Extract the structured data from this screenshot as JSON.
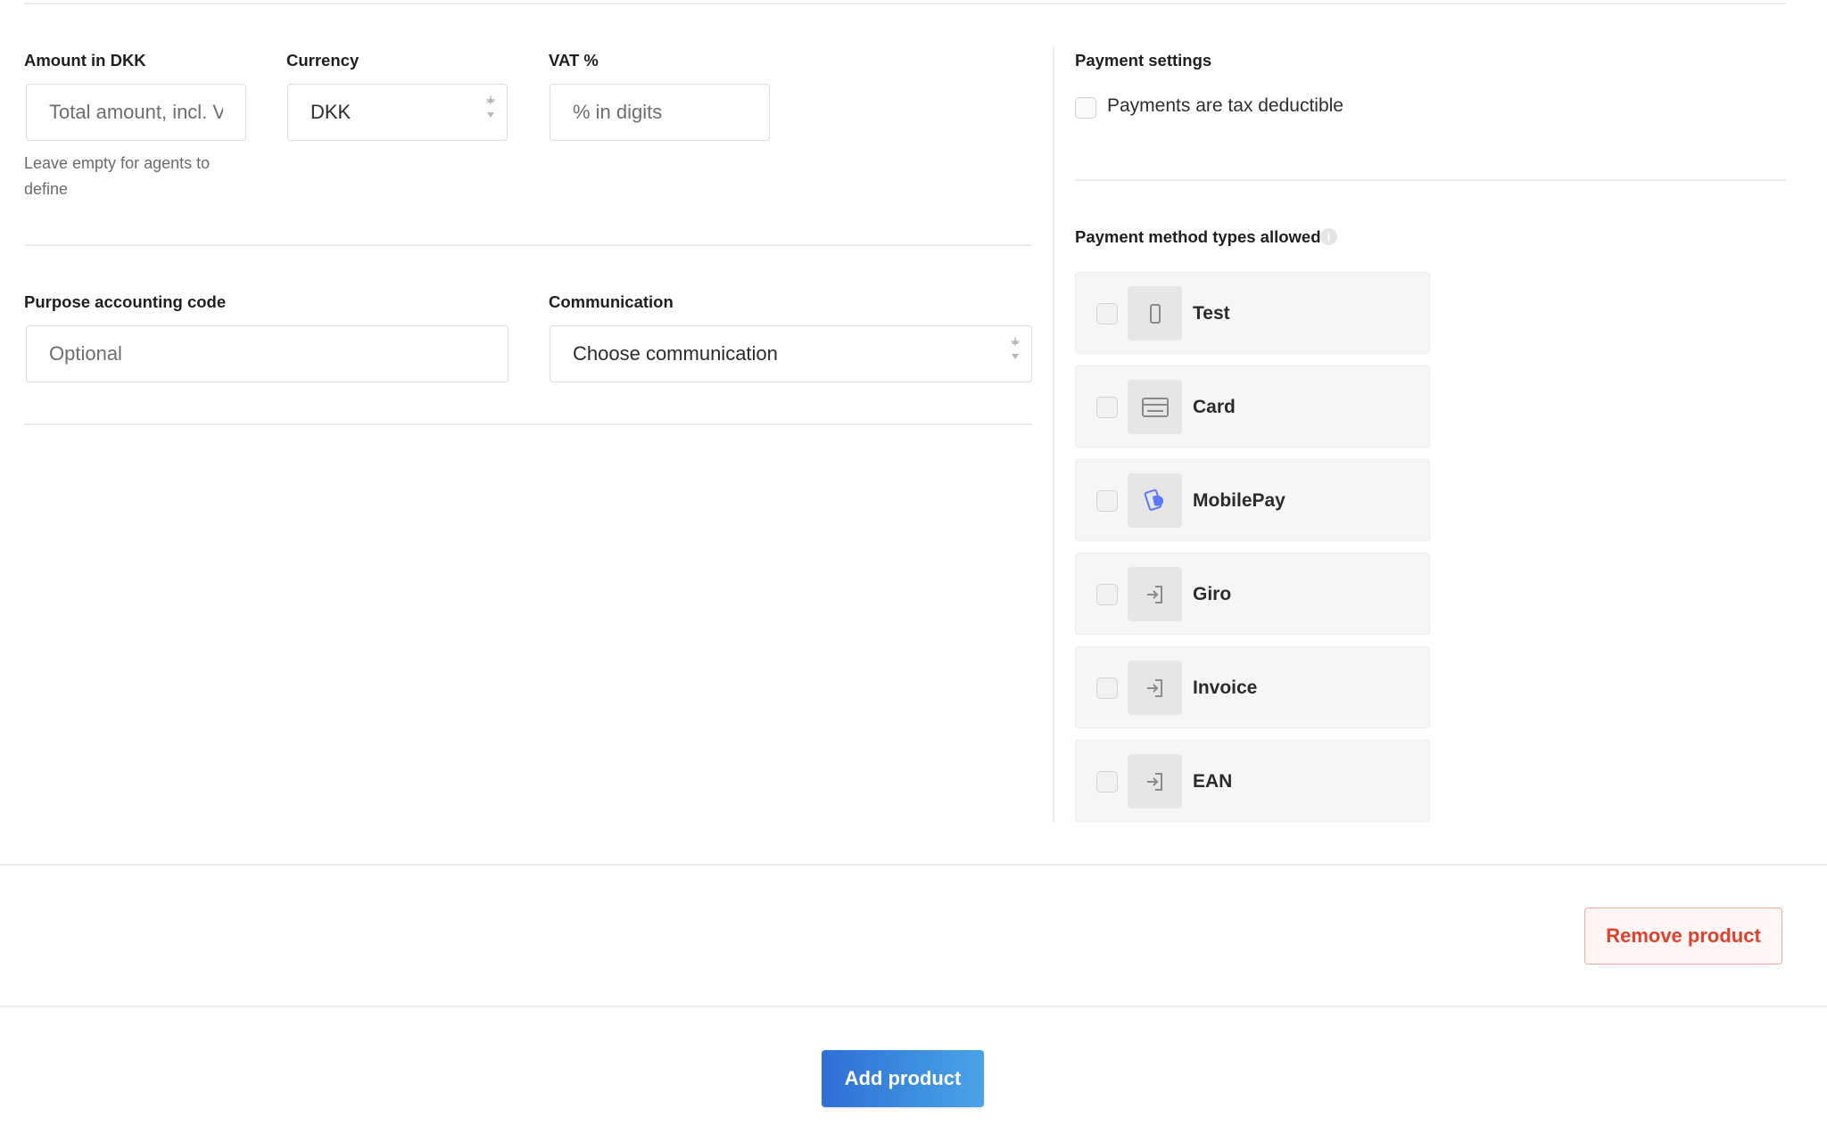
{
  "left": {
    "amount": {
      "label": "Amount in DKK",
      "placeholder": "Total amount, incl. VAT",
      "hint": "Leave empty for agents to define"
    },
    "currency": {
      "label": "Currency",
      "value": "DKK"
    },
    "vat": {
      "label": "VAT %",
      "placeholder": "% in digits"
    },
    "purpose": {
      "label": "Purpose accounting code",
      "placeholder": "Optional"
    },
    "communication": {
      "label": "Communication",
      "value": "Choose communication"
    }
  },
  "right": {
    "payment_settings": {
      "label": "Payment settings",
      "tax_deductible_label": "Payments are tax deductible"
    },
    "methods": {
      "label": "Payment method types allowed",
      "info_icon": "info-icon",
      "items": [
        {
          "label": "Test",
          "icon": "phone-icon"
        },
        {
          "label": "Card",
          "icon": "credit-card-icon"
        },
        {
          "label": "MobilePay",
          "icon": "mobilepay-icon"
        },
        {
          "label": "Giro",
          "icon": "sign-in-icon"
        },
        {
          "label": "Invoice",
          "icon": "sign-in-icon"
        },
        {
          "label": "EAN",
          "icon": "sign-in-icon"
        }
      ]
    }
  },
  "actions": {
    "remove_label": "Remove product",
    "add_label": "Add product"
  },
  "colors": {
    "danger": "#e0412f",
    "primary": "#2f6fd6",
    "mobilepay": "#5a78ff"
  }
}
